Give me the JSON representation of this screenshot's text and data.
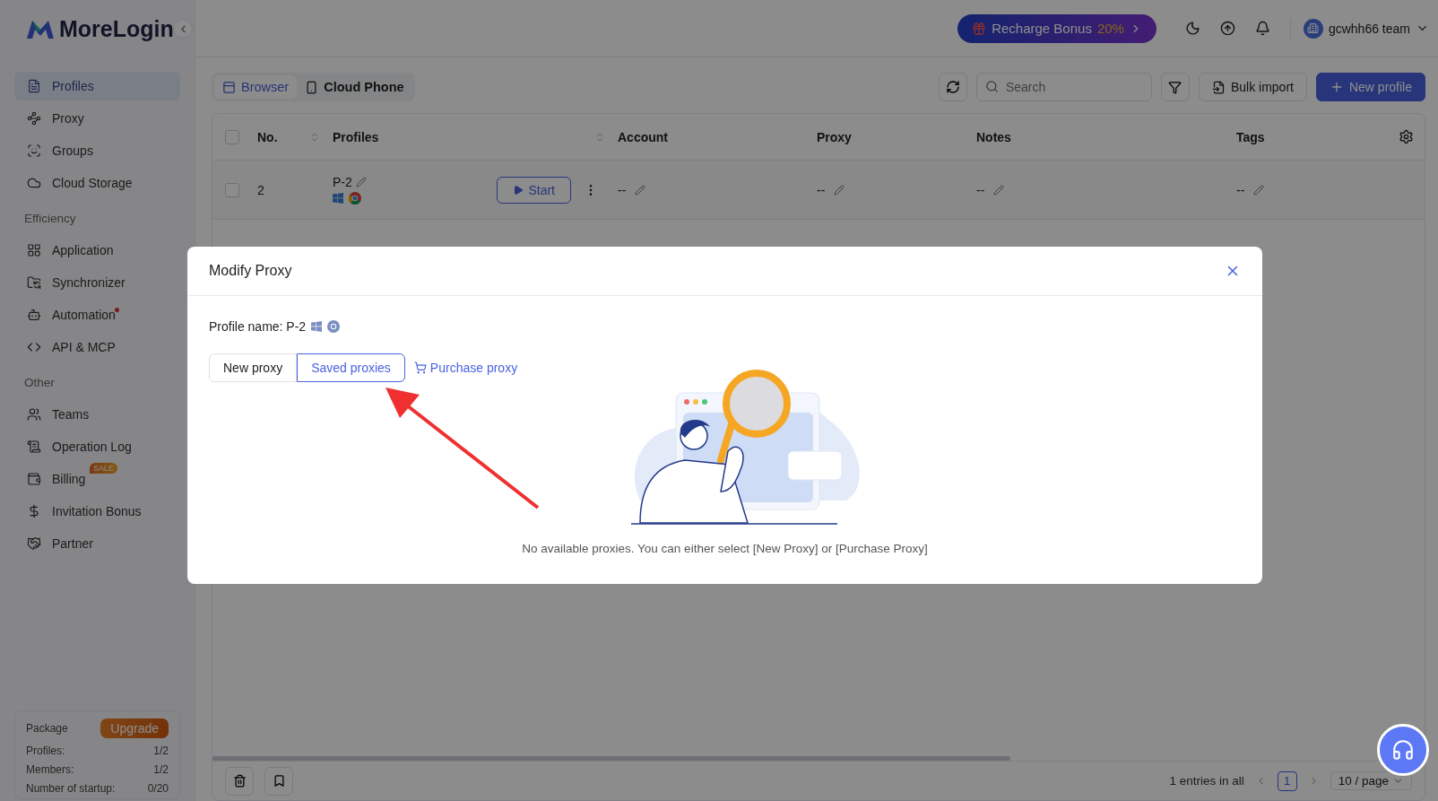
{
  "brand": "MoreLogin",
  "header": {
    "promo": "Recharge Bonus",
    "promo_highlight": "20%",
    "user": "gcwhh66 team"
  },
  "sidebar": {
    "sections": [
      {
        "items": [
          {
            "label": "Profiles",
            "selected": true
          },
          {
            "label": "Proxy",
            "selected": false
          },
          {
            "label": "Groups",
            "selected": false
          },
          {
            "label": "Cloud Storage",
            "selected": false
          }
        ]
      },
      {
        "heading": "Efficiency",
        "items": [
          {
            "label": "Application",
            "selected": false
          },
          {
            "label": "Synchronizer",
            "selected": false
          },
          {
            "label": "Automation",
            "selected": false,
            "dot": true
          },
          {
            "label": "API & MCP",
            "selected": false
          }
        ]
      },
      {
        "heading": "Other",
        "items": [
          {
            "label": "Teams",
            "selected": false
          },
          {
            "label": "Operation Log",
            "selected": false
          },
          {
            "label": "Billing",
            "selected": false,
            "badge": "SALE"
          },
          {
            "label": "Invitation Bonus",
            "selected": false
          },
          {
            "label": "Partner",
            "selected": false
          }
        ]
      }
    ]
  },
  "package": {
    "title": "Package",
    "upgrade": "Upgrade",
    "rows": [
      {
        "label": "Profiles:",
        "value": "1/2"
      },
      {
        "label": "Members:",
        "value": "1/2"
      },
      {
        "label": "Number of startup:",
        "value": "0/20"
      }
    ]
  },
  "tabs": [
    {
      "label": "Browser",
      "selected": true
    },
    {
      "label": "Cloud Phone",
      "selected": false
    }
  ],
  "toolbar": {
    "search_placeholder": "Search",
    "bulk_import": "Bulk import",
    "new_profile": "New profile"
  },
  "table": {
    "columns": [
      "No.",
      "Profiles",
      "Account",
      "Proxy",
      "Notes",
      "Tags"
    ],
    "all_checked": false,
    "rows": [
      {
        "checked": false,
        "no": "2",
        "profile": "P-2",
        "action": "Start",
        "account": "--",
        "proxy": "--",
        "notes": "--",
        "tags": "--"
      }
    ]
  },
  "footer": {
    "entries": "1 entries in all",
    "page": "1",
    "page_size": "10 / page"
  },
  "dialog": {
    "title": "Modify Proxy",
    "profile_name": "Profile name: P-2",
    "tabs": [
      {
        "label": "New proxy",
        "selected": false
      },
      {
        "label": "Saved proxies",
        "selected": true
      }
    ],
    "purchase": "Purchase proxy",
    "empty_message": "No available proxies. You can either select [New Proxy] or [Purchase Proxy]"
  }
}
